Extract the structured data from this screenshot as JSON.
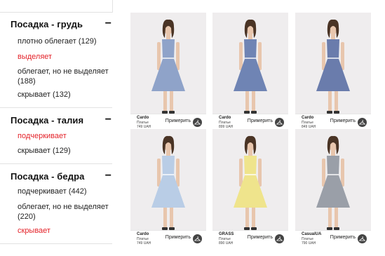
{
  "filters": [
    {
      "title": "Посадка - грудь",
      "collapse_icon": "minus-icon",
      "options": [
        {
          "label": "плотно облегает (129)",
          "active": false
        },
        {
          "label": "выделяет",
          "active": true
        },
        {
          "label": "облегает, но не выделяет (188)",
          "active": false
        },
        {
          "label": "скрывает (132)",
          "active": false
        }
      ]
    },
    {
      "title": "Посадка - талия",
      "collapse_icon": "minus-icon",
      "options": [
        {
          "label": "подчеркивает",
          "active": true
        },
        {
          "label": "скрывает (129)",
          "active": false
        }
      ]
    },
    {
      "title": "Посадка - бедра",
      "collapse_icon": "minus-icon",
      "options": [
        {
          "label": "подчеркивает (442)",
          "active": false
        },
        {
          "label": "облегает, но не выделяет (220)",
          "active": false
        },
        {
          "label": "скрывает",
          "active": true
        }
      ]
    }
  ],
  "products": [
    {
      "brand": "Cardo",
      "type": "Платье",
      "price": "749 UAH",
      "try_label": "Примерить",
      "dress_color": "#8fa3c9"
    },
    {
      "brand": "Cardo",
      "type": "Платье",
      "price": "899 UAH",
      "try_label": "Примерить",
      "dress_color": "#6f84b4"
    },
    {
      "brand": "Cardo",
      "type": "Платье",
      "price": "849 UAH",
      "try_label": "Примерить",
      "dress_color": "#6a7cac"
    },
    {
      "brand": "Cardo",
      "type": "Платье",
      "price": "749 UAH",
      "try_label": "Примерить",
      "dress_color": "#b9cde6"
    },
    {
      "brand": "GRASS",
      "type": "Платье",
      "price": "890 UAH",
      "try_label": "Примерить",
      "dress_color": "#efe48c"
    },
    {
      "brand": "CasualUA",
      "type": "Платье",
      "price": "790 UAH",
      "try_label": "Примерить",
      "dress_color": "#9a9fa8"
    }
  ],
  "colors": {
    "accent_active": "#e4232a",
    "card_bg": "#efedee"
  },
  "icons": {
    "try_on": "hanger-icon",
    "collapse": "minus-icon"
  }
}
